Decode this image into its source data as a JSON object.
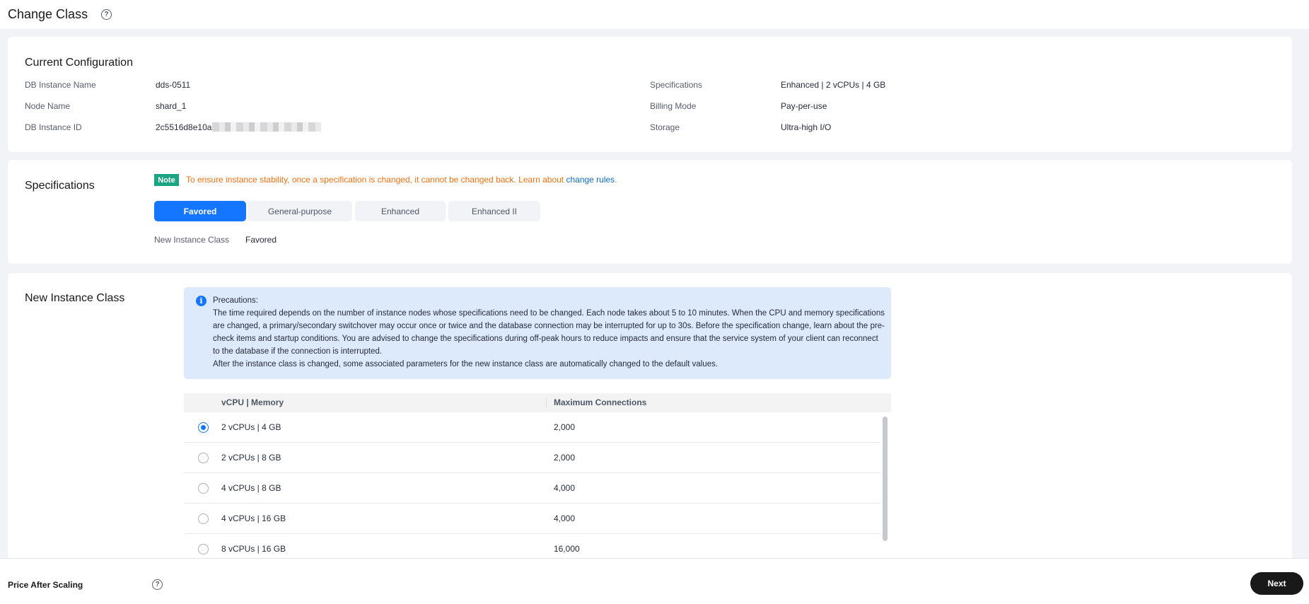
{
  "header": {
    "title": "Change Class",
    "help_icon": "question-circle-icon"
  },
  "current_config": {
    "title": "Current Configuration",
    "fields_left": [
      {
        "label": "DB Instance Name",
        "value": "dds-0511"
      },
      {
        "label": "Node Name",
        "value": "shard_1"
      },
      {
        "label": "DB Instance ID",
        "value": "2c5516d8e10a"
      }
    ],
    "fields_right": [
      {
        "label": "Specifications",
        "value": "Enhanced | 2 vCPUs | 4 GB"
      },
      {
        "label": "Billing Mode",
        "value": "Pay-per-use"
      },
      {
        "label": "Storage",
        "value": "Ultra-high I/O"
      }
    ]
  },
  "specifications": {
    "title": "Specifications",
    "note_badge": "Note",
    "note_text": "To ensure instance stability, once a specification is changed, it cannot be changed back. Learn about ",
    "note_link": "change rules",
    "note_end": ".",
    "tabs": [
      {
        "label": "Favored",
        "active": true
      },
      {
        "label": "General-purpose",
        "active": false
      },
      {
        "label": "Enhanced",
        "active": false
      },
      {
        "label": "Enhanced II",
        "active": false
      }
    ],
    "new_class_label": "New Instance Class",
    "new_class_value": "Favored"
  },
  "new_instance_class": {
    "title": "New Instance Class",
    "precautions": {
      "heading": "Precautions:",
      "body": "The time required depends on the number of instance nodes whose specifications need to be changed. Each node takes about 5 to 10 minutes. When the CPU and memory specifications are changed, a primary/secondary switchover may occur once or twice and the database connection may be interrupted for up to 30s. Before the specification change, learn about the pre-check items and startup conditions. You are advised to change the specifications during off-peak hours to reduce impacts and ensure that the service system of your client can reconnect to the database if the connection is interrupted.",
      "footer": "After the instance class is changed, some associated parameters for the new instance class are automatically changed to the default values."
    },
    "table": {
      "columns": [
        "vCPU | Memory",
        "Maximum Connections"
      ],
      "rows": [
        {
          "spec": "2 vCPUs | 4 GB",
          "connections": "2,000",
          "selected": true
        },
        {
          "spec": "2 vCPUs | 8 GB",
          "connections": "2,000",
          "selected": false
        },
        {
          "spec": "4 vCPUs | 8 GB",
          "connections": "4,000",
          "selected": false
        },
        {
          "spec": "4 vCPUs | 16 GB",
          "connections": "4,000",
          "selected": false
        },
        {
          "spec": "8 vCPUs | 16 GB",
          "connections": "16,000",
          "selected": false
        }
      ]
    }
  },
  "footer": {
    "price_label": "Price After Scaling",
    "next_label": "Next"
  },
  "colors": {
    "accent": "#1476ff",
    "note": "#1aa683",
    "warning": "#f66f0f",
    "link": "#0a6ed1"
  }
}
